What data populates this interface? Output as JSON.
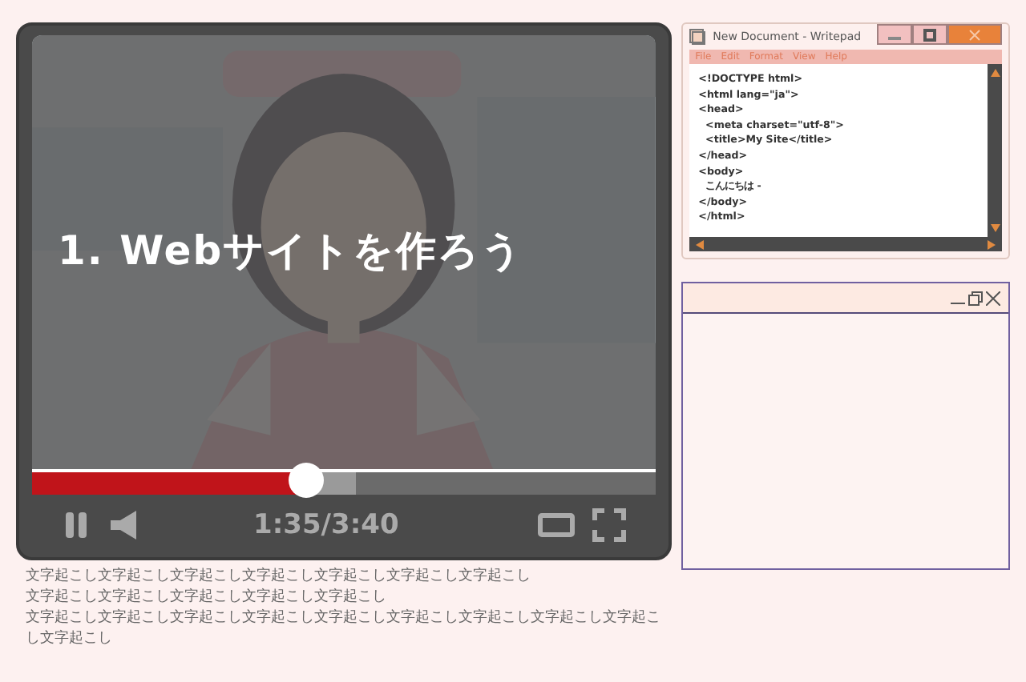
{
  "video": {
    "title": "1. Webサイトを作ろう",
    "buffered": {
      "level": 0.52
    },
    "played": {
      "level": 0.44
    },
    "time": "1:35/3:40"
  },
  "transcript": [
    "文字起こし文字起こし文字起こし文字起こし文字起こし文字起こし文字起こし",
    "文字起こし文字起こし文字起こし文字起こし文字起こし",
    "文字起こし文字起こし文字起こし文字起こし文字起こし文字起こし文字起こし文字起こし文字起こし文字起こし"
  ],
  "editor": {
    "title": "New Document - Writepad",
    "menu": [
      "File",
      "Edit",
      "Format",
      "View",
      "Help"
    ],
    "lines": [
      "<!DOCTYPE html>",
      "<html lang=\"ja\">",
      "<head>",
      "  <meta charset=\"utf-8\">",
      "  <title>My Site</title>",
      "</head>",
      "<body>",
      "  こんにちは -",
      "</body>",
      "</html>"
    ]
  }
}
